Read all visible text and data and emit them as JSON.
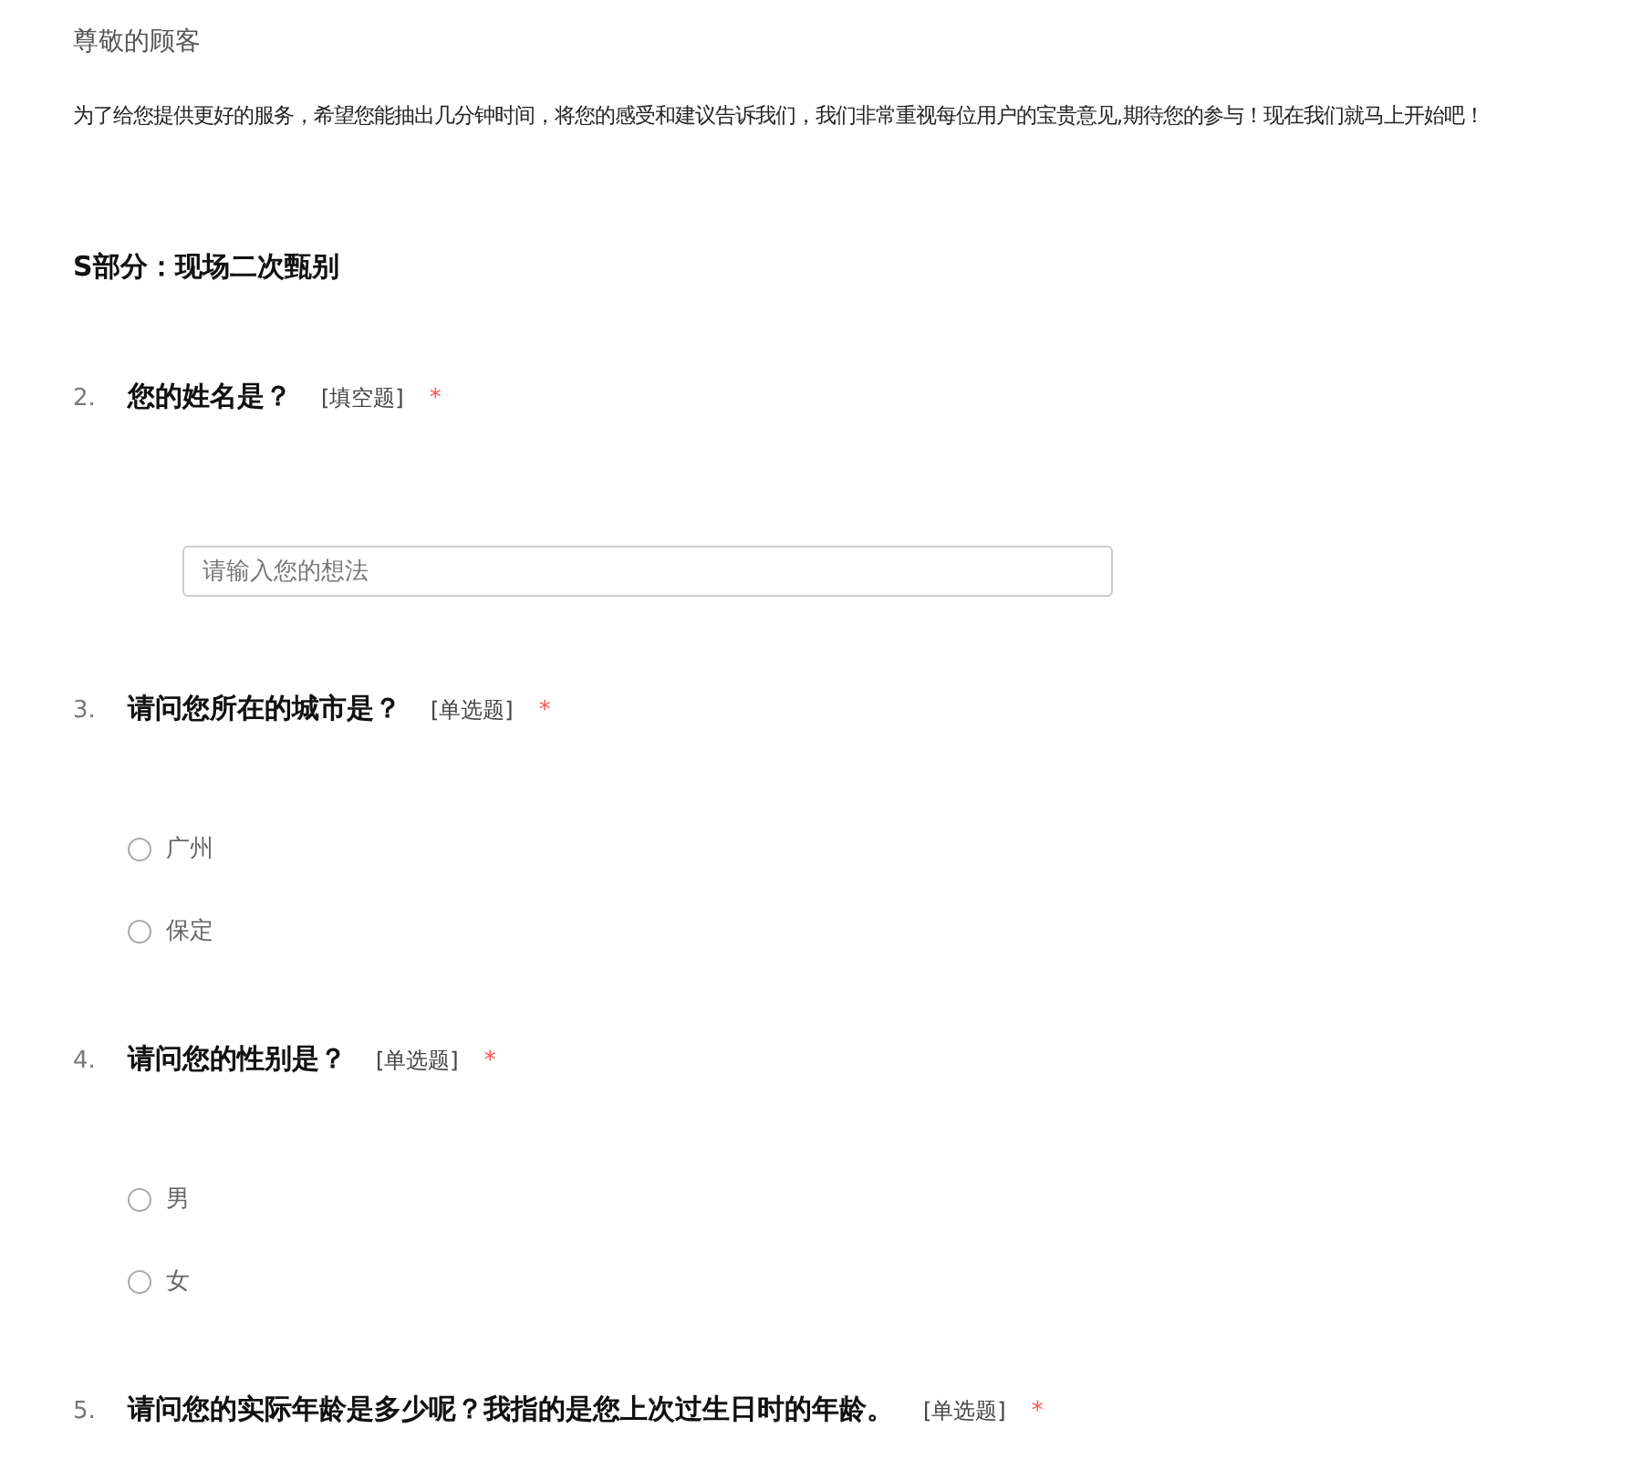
{
  "greeting": "尊敬的顾客",
  "intro": "为了给您提供更好的服务，希望您能抽出几分钟时间，将您的感受和建议告诉我们，我们非常重视每位用户的宝贵意见,期待您的参与！现在我们就马上开始吧！",
  "section": "S部分：现场二次甄别",
  "questions": [
    {
      "number": "2.",
      "title": "您的姓名是？",
      "type": "[填空题]",
      "required_mark": "*",
      "kind": "text",
      "placeholder": "请输入您的想法"
    },
    {
      "number": "3.",
      "title": "请问您所在的城市是？",
      "type": "[单选题]",
      "required_mark": "*",
      "kind": "radio",
      "options": [
        {
          "label": "广州",
          "selected": false
        },
        {
          "label": "保定",
          "selected": false
        }
      ]
    },
    {
      "number": "4.",
      "title": "请问您的性别是？",
      "type": "[单选题]",
      "required_mark": "*",
      "kind": "radio",
      "options": [
        {
          "label": "男",
          "selected": false
        },
        {
          "label": "女",
          "selected": false
        }
      ]
    },
    {
      "number": "5.",
      "title": "请问您的实际年龄是多少呢？我指的是您上次过生日时的年龄。",
      "type": "[单选题]",
      "required_mark": "*",
      "kind": "radio"
    }
  ]
}
